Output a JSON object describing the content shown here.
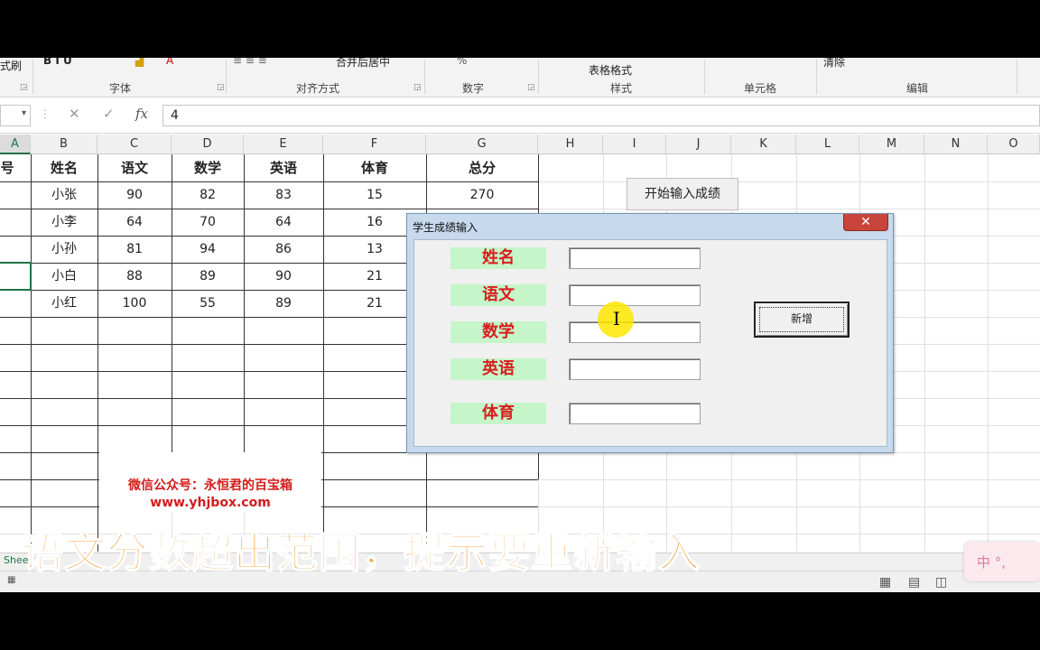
{
  "ribbon": {
    "fragments": [
      "式刷",
      "合并后居中",
      "表格格式",
      "清除"
    ],
    "group_labels": [
      "字体",
      "对齐方式",
      "数字",
      "样式",
      "单元格",
      "编辑"
    ]
  },
  "formula_bar": {
    "cancel_icon": "✕",
    "enter_icon": "✓",
    "fx_label": "fx",
    "value": "4"
  },
  "columns": [
    "A",
    "B",
    "C",
    "D",
    "E",
    "F",
    "G",
    "H",
    "I",
    "J",
    "K",
    "L",
    "M",
    "N",
    "O"
  ],
  "table": {
    "id_header": "号",
    "headers": [
      "姓名",
      "语文",
      "数学",
      "英语",
      "体育",
      "总分"
    ],
    "rows": [
      {
        "name": "小张",
        "chinese": "90",
        "math": "82",
        "english": "83",
        "pe": "15",
        "total": "270"
      },
      {
        "name": "小李",
        "chinese": "64",
        "math": "70",
        "english": "64",
        "pe": "16",
        "total": ""
      },
      {
        "name": "小孙",
        "chinese": "81",
        "math": "94",
        "english": "86",
        "pe": "13",
        "total": ""
      },
      {
        "name": "小白",
        "chinese": "88",
        "math": "89",
        "english": "90",
        "pe": "21",
        "total": ""
      },
      {
        "name": "小红",
        "chinese": "100",
        "math": "55",
        "english": "89",
        "pe": "21",
        "total": ""
      }
    ]
  },
  "sheet_button": "开始输入成绩",
  "dialog": {
    "title": "学生成绩输入",
    "close_icon": "✕",
    "fields": [
      {
        "label": "姓名",
        "value": ""
      },
      {
        "label": "语文",
        "value": ""
      },
      {
        "label": "数学",
        "value": ""
      },
      {
        "label": "英语",
        "value": ""
      },
      {
        "label": "体育",
        "value": ""
      }
    ],
    "new_button": "新增"
  },
  "watermark": {
    "line1": "微信公众号：永恒君的百宝箱",
    "line2": "www.yhjbox.com"
  },
  "sheet_tab": "Shee",
  "ime": {
    "text": "中 °,"
  },
  "subtitle": "语文分数超出范围，提示要重新输入",
  "colors": {
    "label_bg": "#c5f5c9",
    "label_text": "#d81e1e",
    "subtitle": "#f3a64a",
    "accent": "#217346"
  }
}
